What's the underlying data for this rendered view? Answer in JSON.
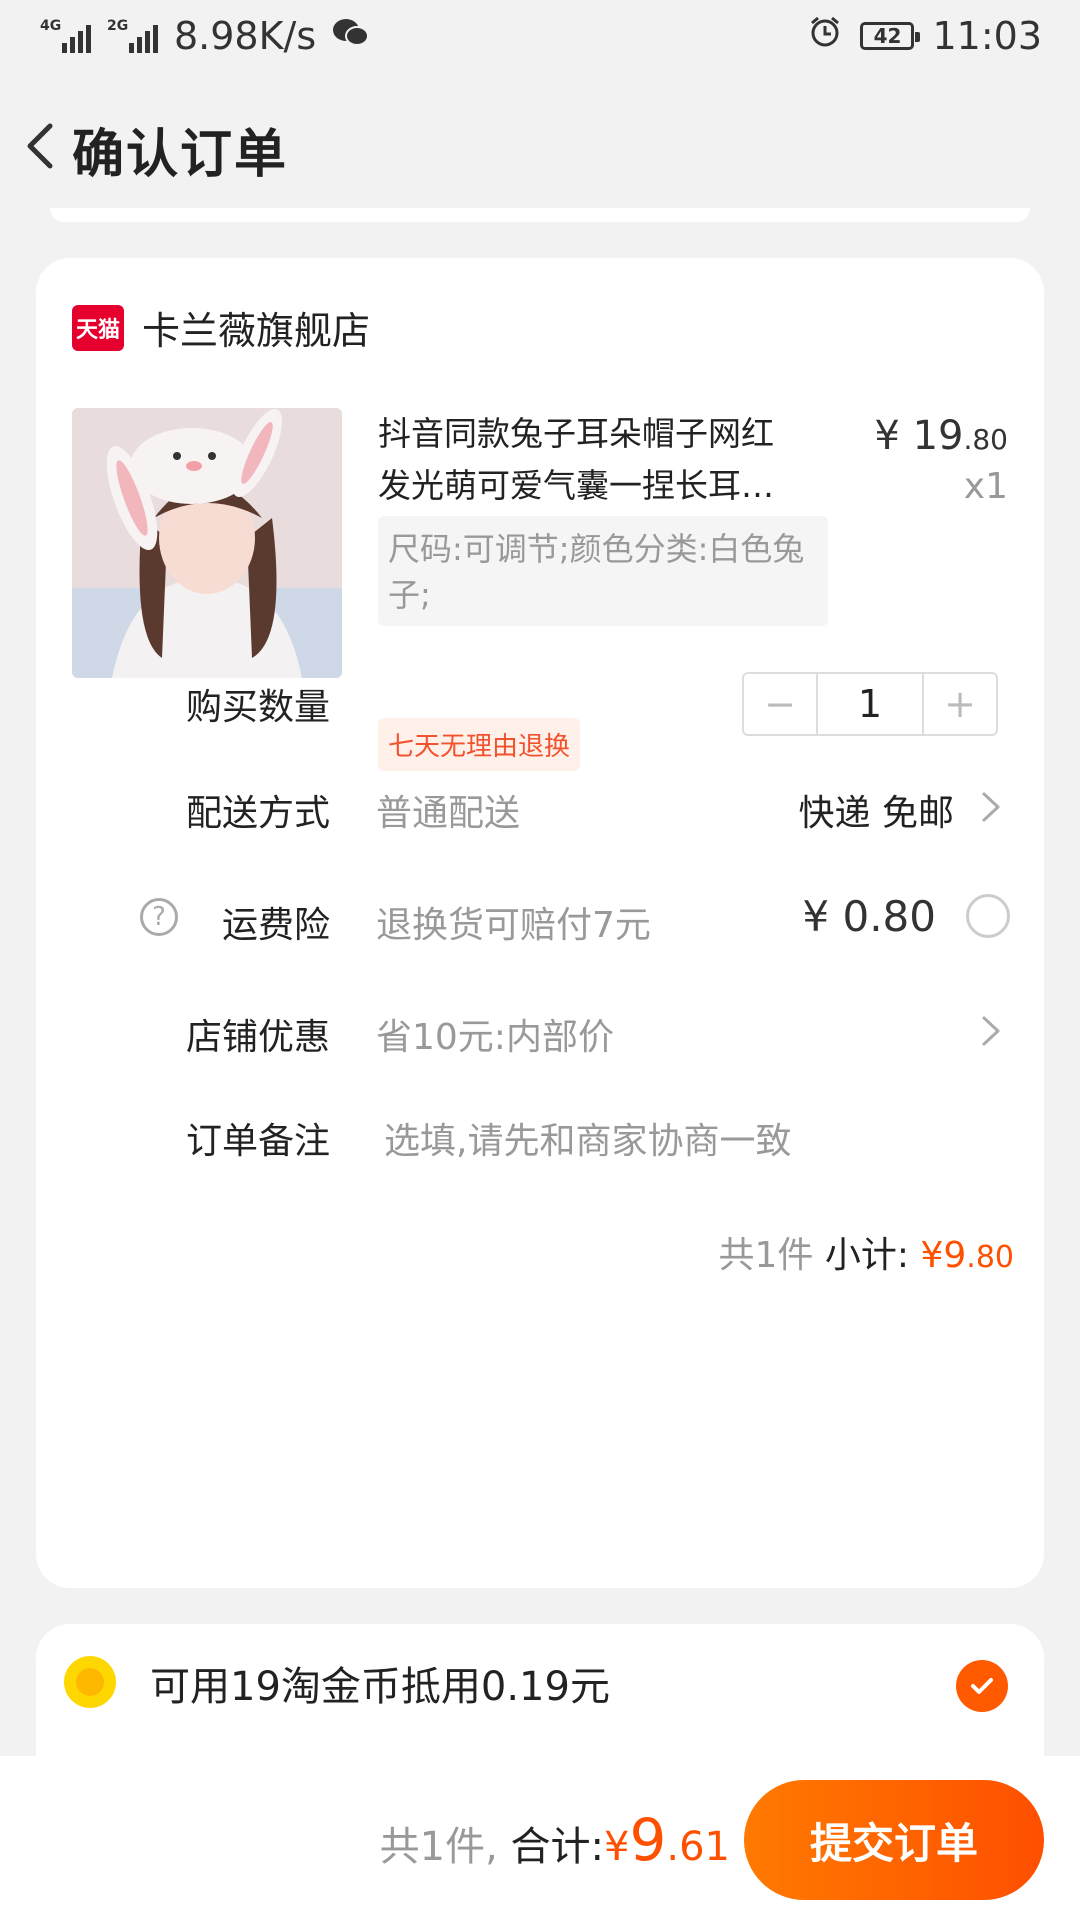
{
  "status_bar": {
    "net_1": "4G",
    "net_2": "2G",
    "speed": "8.98K/s",
    "battery": "42",
    "time": "11:03"
  },
  "nav": {
    "title": "确认订单"
  },
  "shop": {
    "badge": "天猫",
    "name": "卡兰薇旗舰店"
  },
  "product": {
    "title_line1": "抖音同款兔子耳朵帽子网红",
    "title_line2": "发光萌可爱气囊一捏长耳…",
    "sku": "尺码:可调节;颜色分类:白色兔子;",
    "price_main": "¥ 19",
    "price_decimal": ".80",
    "qty": "x1",
    "return_tag": "七天无理由退换"
  },
  "quantity": {
    "label": "购买数量",
    "minus": "−",
    "value": "1",
    "plus": "+"
  },
  "delivery": {
    "label": "配送方式",
    "method": "普通配送",
    "value": "快递 免邮"
  },
  "insurance": {
    "help": "?",
    "label": "运费险",
    "desc": "退换货可赔付7元",
    "price": "¥ 0.80"
  },
  "discount": {
    "label": "店铺优惠",
    "value": "省10元:内部价"
  },
  "note": {
    "label": "订单备注",
    "placeholder": "选填,请先和商家协商一致"
  },
  "subtotal": {
    "count": "共1件",
    "label": "小计:",
    "currency": "¥",
    "amount_main": "9",
    "amount_decimal": ".80"
  },
  "coins": {
    "text": "可用19淘金币抵用0.19元",
    "checked": true
  },
  "footer": {
    "count": "共1件,",
    "label": "合计:",
    "currency": "¥",
    "amount_main": "9",
    "amount_decimal": ".61",
    "submit": "提交订单"
  },
  "colors": {
    "accent": "#ff5000",
    "tmall_red": "#e6002d"
  }
}
